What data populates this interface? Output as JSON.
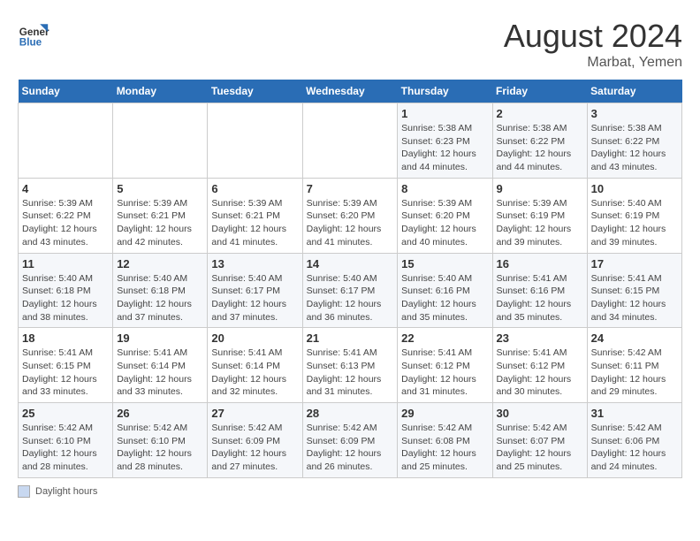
{
  "header": {
    "logo_line1": "General",
    "logo_line2": "Blue",
    "month_year": "August 2024",
    "location": "Marbat, Yemen"
  },
  "legend": {
    "box_label": "Daylight hours"
  },
  "days_of_week": [
    "Sunday",
    "Monday",
    "Tuesday",
    "Wednesday",
    "Thursday",
    "Friday",
    "Saturday"
  ],
  "weeks": [
    [
      {
        "num": "",
        "info": ""
      },
      {
        "num": "",
        "info": ""
      },
      {
        "num": "",
        "info": ""
      },
      {
        "num": "",
        "info": ""
      },
      {
        "num": "1",
        "info": "Sunrise: 5:38 AM\nSunset: 6:23 PM\nDaylight: 12 hours\nand 44 minutes."
      },
      {
        "num": "2",
        "info": "Sunrise: 5:38 AM\nSunset: 6:22 PM\nDaylight: 12 hours\nand 44 minutes."
      },
      {
        "num": "3",
        "info": "Sunrise: 5:38 AM\nSunset: 6:22 PM\nDaylight: 12 hours\nand 43 minutes."
      }
    ],
    [
      {
        "num": "4",
        "info": "Sunrise: 5:39 AM\nSunset: 6:22 PM\nDaylight: 12 hours\nand 43 minutes."
      },
      {
        "num": "5",
        "info": "Sunrise: 5:39 AM\nSunset: 6:21 PM\nDaylight: 12 hours\nand 42 minutes."
      },
      {
        "num": "6",
        "info": "Sunrise: 5:39 AM\nSunset: 6:21 PM\nDaylight: 12 hours\nand 41 minutes."
      },
      {
        "num": "7",
        "info": "Sunrise: 5:39 AM\nSunset: 6:20 PM\nDaylight: 12 hours\nand 41 minutes."
      },
      {
        "num": "8",
        "info": "Sunrise: 5:39 AM\nSunset: 6:20 PM\nDaylight: 12 hours\nand 40 minutes."
      },
      {
        "num": "9",
        "info": "Sunrise: 5:39 AM\nSunset: 6:19 PM\nDaylight: 12 hours\nand 39 minutes."
      },
      {
        "num": "10",
        "info": "Sunrise: 5:40 AM\nSunset: 6:19 PM\nDaylight: 12 hours\nand 39 minutes."
      }
    ],
    [
      {
        "num": "11",
        "info": "Sunrise: 5:40 AM\nSunset: 6:18 PM\nDaylight: 12 hours\nand 38 minutes."
      },
      {
        "num": "12",
        "info": "Sunrise: 5:40 AM\nSunset: 6:18 PM\nDaylight: 12 hours\nand 37 minutes."
      },
      {
        "num": "13",
        "info": "Sunrise: 5:40 AM\nSunset: 6:17 PM\nDaylight: 12 hours\nand 37 minutes."
      },
      {
        "num": "14",
        "info": "Sunrise: 5:40 AM\nSunset: 6:17 PM\nDaylight: 12 hours\nand 36 minutes."
      },
      {
        "num": "15",
        "info": "Sunrise: 5:40 AM\nSunset: 6:16 PM\nDaylight: 12 hours\nand 35 minutes."
      },
      {
        "num": "16",
        "info": "Sunrise: 5:41 AM\nSunset: 6:16 PM\nDaylight: 12 hours\nand 35 minutes."
      },
      {
        "num": "17",
        "info": "Sunrise: 5:41 AM\nSunset: 6:15 PM\nDaylight: 12 hours\nand 34 minutes."
      }
    ],
    [
      {
        "num": "18",
        "info": "Sunrise: 5:41 AM\nSunset: 6:15 PM\nDaylight: 12 hours\nand 33 minutes."
      },
      {
        "num": "19",
        "info": "Sunrise: 5:41 AM\nSunset: 6:14 PM\nDaylight: 12 hours\nand 33 minutes."
      },
      {
        "num": "20",
        "info": "Sunrise: 5:41 AM\nSunset: 6:14 PM\nDaylight: 12 hours\nand 32 minutes."
      },
      {
        "num": "21",
        "info": "Sunrise: 5:41 AM\nSunset: 6:13 PM\nDaylight: 12 hours\nand 31 minutes."
      },
      {
        "num": "22",
        "info": "Sunrise: 5:41 AM\nSunset: 6:12 PM\nDaylight: 12 hours\nand 31 minutes."
      },
      {
        "num": "23",
        "info": "Sunrise: 5:41 AM\nSunset: 6:12 PM\nDaylight: 12 hours\nand 30 minutes."
      },
      {
        "num": "24",
        "info": "Sunrise: 5:42 AM\nSunset: 6:11 PM\nDaylight: 12 hours\nand 29 minutes."
      }
    ],
    [
      {
        "num": "25",
        "info": "Sunrise: 5:42 AM\nSunset: 6:10 PM\nDaylight: 12 hours\nand 28 minutes."
      },
      {
        "num": "26",
        "info": "Sunrise: 5:42 AM\nSunset: 6:10 PM\nDaylight: 12 hours\nand 28 minutes."
      },
      {
        "num": "27",
        "info": "Sunrise: 5:42 AM\nSunset: 6:09 PM\nDaylight: 12 hours\nand 27 minutes."
      },
      {
        "num": "28",
        "info": "Sunrise: 5:42 AM\nSunset: 6:09 PM\nDaylight: 12 hours\nand 26 minutes."
      },
      {
        "num": "29",
        "info": "Sunrise: 5:42 AM\nSunset: 6:08 PM\nDaylight: 12 hours\nand 25 minutes."
      },
      {
        "num": "30",
        "info": "Sunrise: 5:42 AM\nSunset: 6:07 PM\nDaylight: 12 hours\nand 25 minutes."
      },
      {
        "num": "31",
        "info": "Sunrise: 5:42 AM\nSunset: 6:06 PM\nDaylight: 12 hours\nand 24 minutes."
      }
    ]
  ]
}
